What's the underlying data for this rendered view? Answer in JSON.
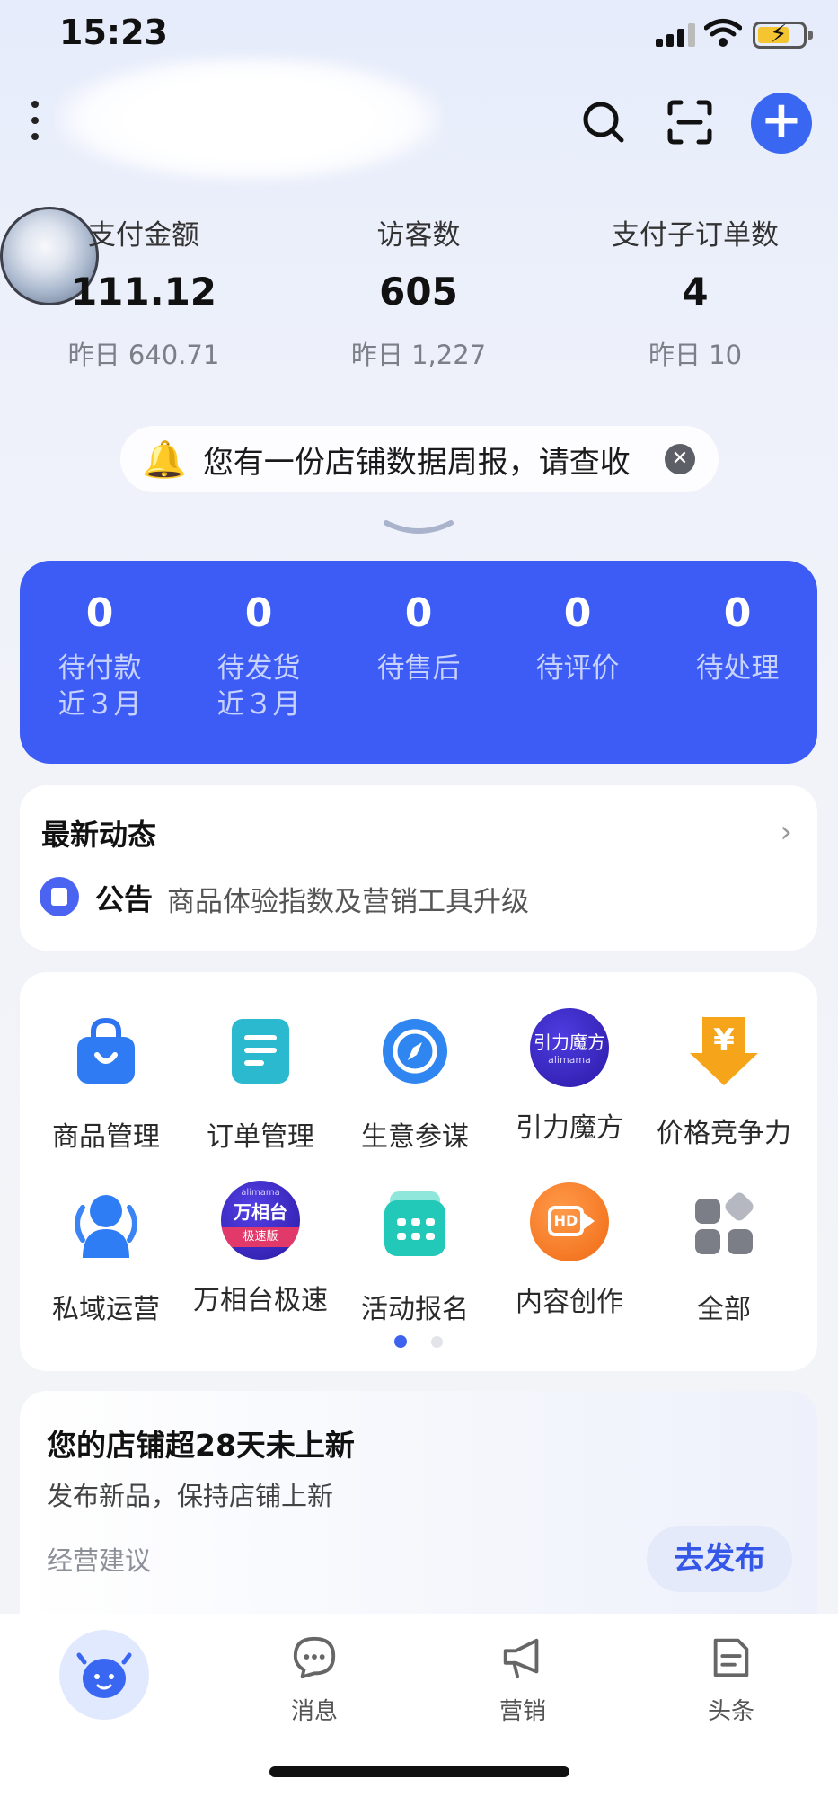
{
  "status_bar": {
    "time": "15:23"
  },
  "stats": [
    {
      "label": "支付金额",
      "value": "111.12",
      "prev": "昨日 640.71"
    },
    {
      "label": "访客数",
      "value": "605",
      "prev": "昨日 1,227"
    },
    {
      "label": "支付子订单数",
      "value": "4",
      "prev": "昨日 10"
    }
  ],
  "report": {
    "text": "您有一份店铺数据周报，请查收",
    "close": "✕"
  },
  "orders": [
    {
      "count": "0",
      "label": "待付款",
      "sub": "近３月"
    },
    {
      "count": "0",
      "label": "待发货",
      "sub": "近３月"
    },
    {
      "count": "0",
      "label": "待售后",
      "sub": ""
    },
    {
      "count": "0",
      "label": "待评价",
      "sub": ""
    },
    {
      "count": "0",
      "label": "待处理",
      "sub": ""
    }
  ],
  "news": {
    "title": "最新动态",
    "tag": "公告",
    "text": "商品体验指数及营销工具升级",
    "arrow": "›"
  },
  "tools": [
    {
      "label": "商品管理",
      "icon": "shopping-bag-icon"
    },
    {
      "label": "订单管理",
      "icon": "order-list-icon"
    },
    {
      "label": "生意参谋",
      "icon": "compass-icon"
    },
    {
      "label": "引力魔方",
      "icon": "yinli-mofang-icon",
      "icon_text": "引力魔方",
      "icon_sub": "alimama"
    },
    {
      "label": "价格竞争力",
      "icon": "price-yen-icon",
      "icon_text": "¥"
    },
    {
      "label": "私域运营",
      "icon": "private-domain-icon"
    },
    {
      "label": "万相台极速",
      "icon": "wanxiangtai-icon",
      "icon_text": "万相台",
      "icon_top": "alimama",
      "icon_sub": "极速版"
    },
    {
      "label": "活动报名",
      "icon": "calendar-icon"
    },
    {
      "label": "内容创作",
      "icon": "hd-video-icon",
      "icon_text": "HD"
    },
    {
      "label": "全部",
      "icon": "all-apps-icon"
    }
  ],
  "suggestion": {
    "title": "您的店铺超28天未上新",
    "subtitle": "发布新品，保持店铺上新",
    "tag": "经营建议",
    "button": "去发布"
  },
  "bottom_nav": [
    {
      "label": "",
      "icon": "home-bull-icon"
    },
    {
      "label": "消息",
      "icon": "message-icon"
    },
    {
      "label": "营销",
      "icon": "megaphone-icon"
    },
    {
      "label": "头条",
      "icon": "headline-icon"
    }
  ],
  "colors": {
    "primary": "#3d5cf5",
    "accent": "#3a67f2",
    "background": "#eef1fa"
  }
}
